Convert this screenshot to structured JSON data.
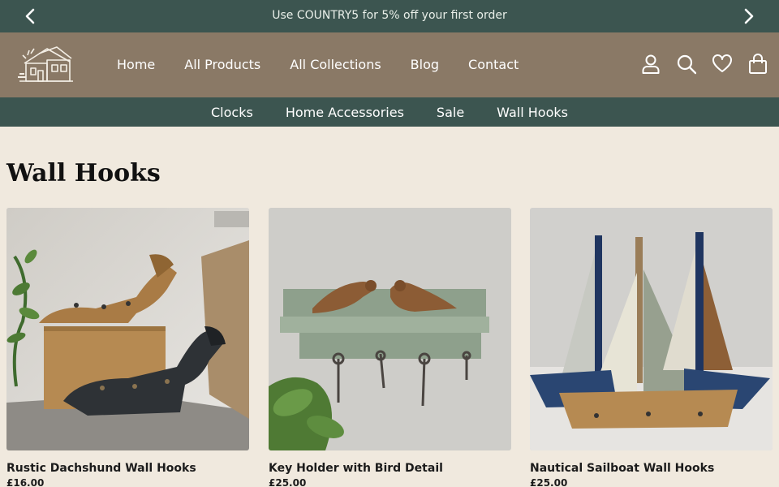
{
  "announcement": {
    "text": "Use COUNTRY5 for 5% off your first order"
  },
  "header": {
    "nav": [
      "Home",
      "All Products",
      "All Collections",
      "Blog",
      "Contact"
    ],
    "icons": [
      "account-icon",
      "search-icon",
      "wishlist-heart-icon",
      "cart-bag-icon"
    ]
  },
  "subnav": [
    "Clocks",
    "Home Accessories",
    "Sale",
    "Wall Hooks"
  ],
  "page": {
    "title": "Wall Hooks"
  },
  "products": [
    {
      "name": "Rustic Dachshund Wall Hooks",
      "price": "£16.00"
    },
    {
      "name": "Key Holder with Bird Detail",
      "price": "£25.00"
    },
    {
      "name": "Nautical Sailboat Wall Hooks",
      "price": "£25.00"
    }
  ],
  "colors": {
    "dark_green": "#3c5550",
    "header_brown": "#8a7966",
    "background": "#f0e9de"
  }
}
